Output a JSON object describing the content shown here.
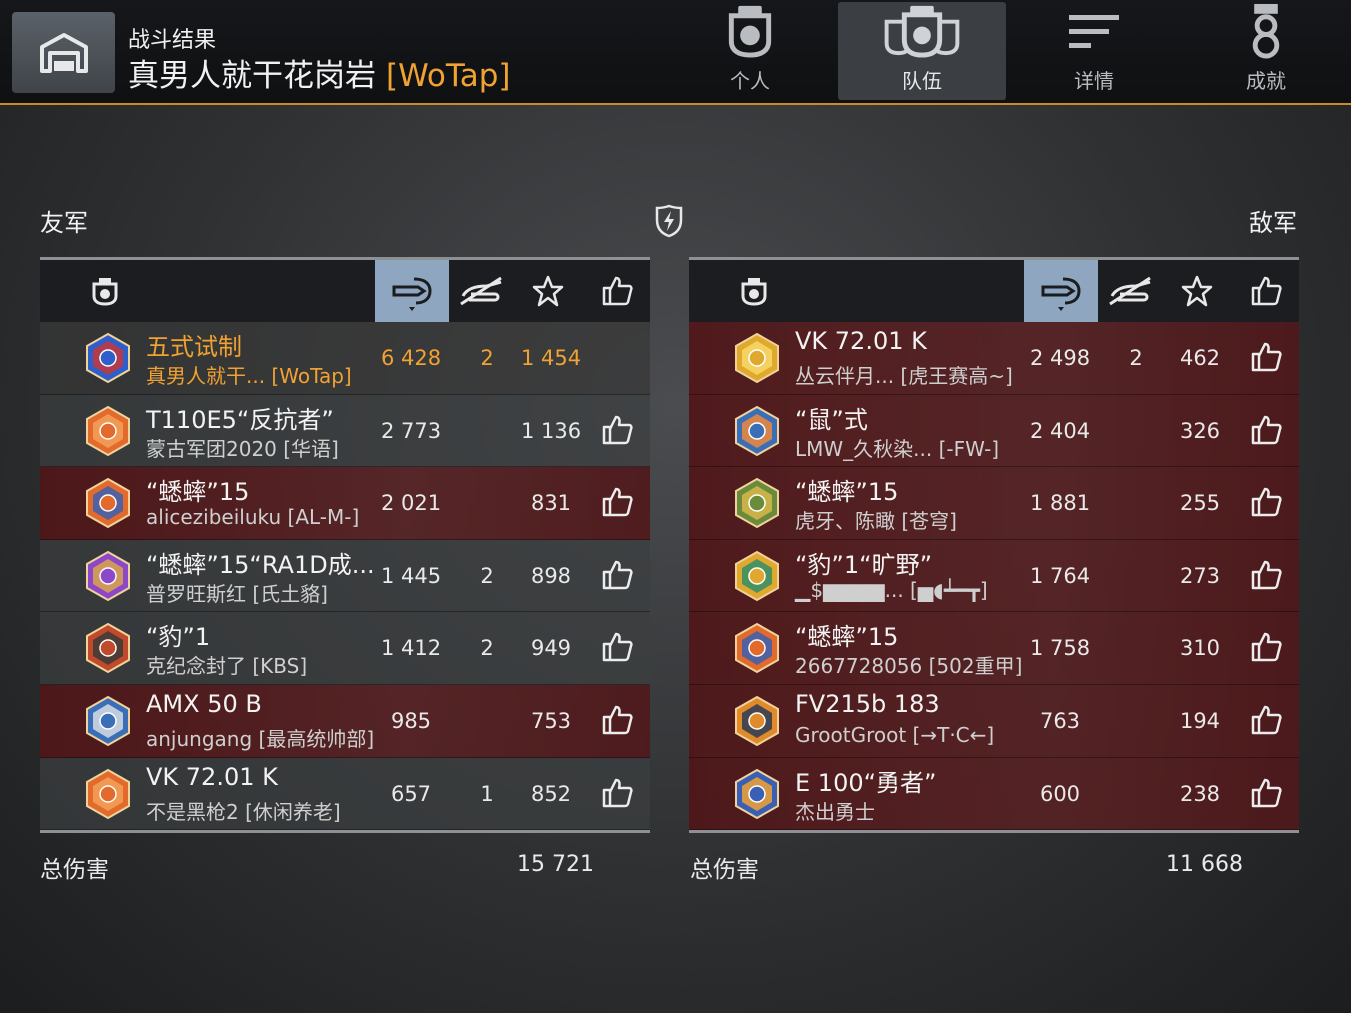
{
  "header": {
    "subtitle": "战斗结果",
    "map_name": "真男人就干花岗岩",
    "clan_tag": "[WoTap]",
    "tabs": [
      {
        "label": "个人",
        "icon": "tank-crew-icon",
        "active": false
      },
      {
        "label": "队伍",
        "icon": "team-icon",
        "active": true
      },
      {
        "label": "详情",
        "icon": "details-list-icon",
        "active": false
      },
      {
        "label": "成就",
        "icon": "medal-icon",
        "active": false
      }
    ]
  },
  "allies": {
    "title": "友军",
    "total_label": "总伤害",
    "total_damage": "15 721",
    "rows": [
      {
        "vehicle": "五式试制",
        "player": "真男人就干...  [WoTap]",
        "damage": "6 428",
        "kills": "2",
        "xp": "1 454",
        "liked": false,
        "me": true,
        "badge": "crest-red-blue"
      },
      {
        "vehicle": "T110E5“反抗者”",
        "player": "蒙古军团2020 [华语]",
        "damage": "2 773",
        "kills": "",
        "xp": "1 136",
        "liked": true,
        "me": false,
        "badge": "tank-orange"
      },
      {
        "vehicle": "“蟋蟀”15",
        "player": "alicezibeiluku [AL-M-]",
        "damage": "2 021",
        "kills": "",
        "xp": "831",
        "liked": true,
        "me": false,
        "badge": "shield-2"
      },
      {
        "vehicle": "“蟋蟀”15“RA1D成...",
        "player": "普罗旺斯红 [氏土貉]",
        "damage": "1 445",
        "kills": "2",
        "xp": "898",
        "liked": true,
        "me": false,
        "badge": "tiger-purple"
      },
      {
        "vehicle": "“豹”1",
        "player": "克纪念封了 [KBS]",
        "damage": "1 412",
        "kills": "2",
        "xp": "949",
        "liked": true,
        "me": false,
        "badge": "spartan-red"
      },
      {
        "vehicle": "AMX 50 B",
        "player": "anjungang [最高统帅部]",
        "damage": "985",
        "kills": "",
        "xp": "753",
        "liked": true,
        "me": false,
        "badge": "guns-blue"
      },
      {
        "vehicle": "VK 72.01 K",
        "player": "不是黑枪2 [休闲养老]",
        "damage": "657",
        "kills": "1",
        "xp": "852",
        "liked": true,
        "me": false,
        "badge": "tank-orange"
      }
    ]
  },
  "enemies": {
    "title": "敌军",
    "total_label": "总伤害",
    "total_damage": "11 668",
    "rows": [
      {
        "vehicle": "VK 72.01 K",
        "player": "丛云伴月...  [虎王赛高~]",
        "damage": "2 498",
        "kills": "2",
        "xp": "462",
        "liked": true,
        "badge": "diamond-gold"
      },
      {
        "vehicle": "“鼠”式",
        "player": "LMW_久秋染...  [-FW-]",
        "damage": "2 404",
        "kills": "",
        "xp": "326",
        "liked": true,
        "badge": "award-blue"
      },
      {
        "vehicle": "“蟋蟀”15",
        "player": "虎牙、陈瞰 [苍穹]",
        "damage": "1 881",
        "kills": "",
        "xp": "255",
        "liked": true,
        "badge": "tank-green"
      },
      {
        "vehicle": "“豹”1“旷野”",
        "player": "▁$▆▆▆▆...  [▅◖┷━┳]",
        "damage": "1 764",
        "kills": "",
        "xp": "273",
        "liked": true,
        "badge": "shield-3"
      },
      {
        "vehicle": "“蟋蟀”15",
        "player": "2667728056 [502重甲]",
        "damage": "1 758",
        "kills": "",
        "xp": "310",
        "liked": true,
        "badge": "shield-2"
      },
      {
        "vehicle": "FV215b 183",
        "player": "GrootGroot [→T·C←]",
        "damage": "763",
        "kills": "",
        "xp": "194",
        "liked": true,
        "badge": "tank-dark"
      },
      {
        "vehicle": "E 100“勇者”",
        "player": "杰出勇士",
        "damage": "600",
        "kills": "",
        "xp": "238",
        "liked": true,
        "badge": "duck-blue"
      }
    ]
  },
  "colors": {
    "accent": "#f0a232",
    "sorted_column": "#8ea6bf",
    "loss_row": "#5a1e20"
  }
}
